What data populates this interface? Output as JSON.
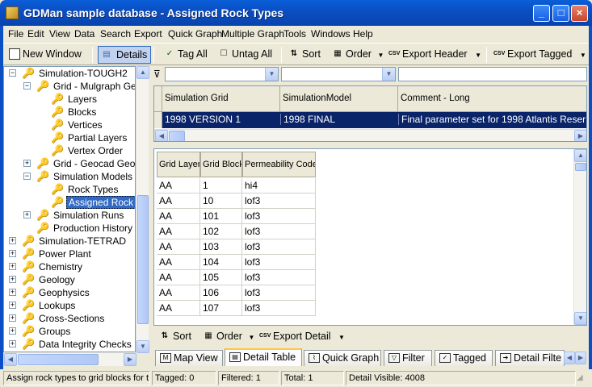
{
  "window": {
    "title": "GDMan sample database - Assigned Rock Types",
    "min": "_",
    "max": "□",
    "close": "×"
  },
  "menu": [
    "File",
    "Edit",
    "View",
    "Data",
    "Search",
    "Export",
    "Quick Graph",
    "Multiple Graph",
    "Tools",
    "Windows",
    "Help"
  ],
  "toolbar": {
    "new_window": "New Window",
    "details": "Details",
    "tag_all": "Tag All",
    "untag_all": "Untag All",
    "sort": "Sort",
    "order": "Order",
    "export_header": "Export Header",
    "export_tagged": "Export Tagged"
  },
  "tree": [
    {
      "label": "Simulation-TOUGH2"
    },
    {
      "label": "Grid - Mulgraph Ge"
    },
    {
      "label": "Layers"
    },
    {
      "label": "Blocks"
    },
    {
      "label": "Vertices"
    },
    {
      "label": "Partial Layers"
    },
    {
      "label": "Vertex Order"
    },
    {
      "label": "Grid - Geocad Geor"
    },
    {
      "label": "Simulation Models"
    },
    {
      "label": "Rock Types"
    },
    {
      "label": "Assigned Rock"
    },
    {
      "label": "Simulation Runs"
    },
    {
      "label": "Production History"
    },
    {
      "label": "Simulation-TETRAD"
    },
    {
      "label": "Power Plant"
    },
    {
      "label": "Chemistry"
    },
    {
      "label": "Geology"
    },
    {
      "label": "Geophysics"
    },
    {
      "label": "Lookups"
    },
    {
      "label": "Cross-Sections"
    },
    {
      "label": "Groups"
    },
    {
      "label": "Data Integrity Checks"
    }
  ],
  "header_grid": {
    "columns": [
      "Simulation Grid",
      "SimulationModel",
      "Comment - Long"
    ],
    "row": [
      "1998 VERSION 1",
      "1998 FINAL",
      "Final parameter set for 1998 Atlantis Reser"
    ]
  },
  "detail_grid": {
    "columns": [
      "Grid Layer",
      "Grid Block",
      "Permeability Code"
    ],
    "rows": [
      [
        "AA",
        "1",
        "hi4"
      ],
      [
        "AA",
        "10",
        "lof3"
      ],
      [
        "AA",
        "101",
        "lof3"
      ],
      [
        "AA",
        "102",
        "lof3"
      ],
      [
        "AA",
        "103",
        "lof3"
      ],
      [
        "AA",
        "104",
        "lof3"
      ],
      [
        "AA",
        "105",
        "lof3"
      ],
      [
        "AA",
        "106",
        "lof3"
      ],
      [
        "AA",
        "107",
        "lof3"
      ]
    ]
  },
  "detail_toolbar": {
    "sort": "Sort",
    "order": "Order",
    "export_detail": "Export Detail"
  },
  "tabs": [
    "Map View",
    "Detail Table",
    "Quick Graph",
    "Filter",
    "Tagged",
    "Detail Filte"
  ],
  "status": {
    "hint": "Assign rock types to grid blocks for th",
    "tagged": "Tagged: 0",
    "filtered": "Filtered: 1",
    "total": "Total: 1",
    "detail_visible": "Detail Visible: 4008"
  },
  "colors": {
    "titlebar": "#0b4fc4",
    "selection": "#0a246a",
    "tab_highlight": "#ffc83c"
  }
}
